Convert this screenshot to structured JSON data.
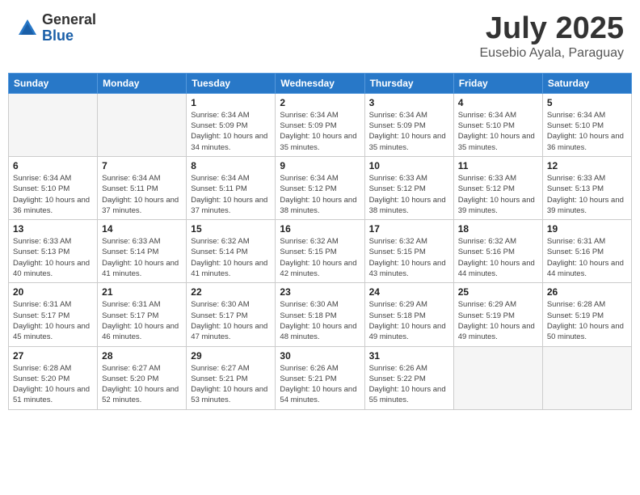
{
  "header": {
    "logo_general": "General",
    "logo_blue": "Blue",
    "month": "July 2025",
    "location": "Eusebio Ayala, Paraguay"
  },
  "weekdays": [
    "Sunday",
    "Monday",
    "Tuesday",
    "Wednesday",
    "Thursday",
    "Friday",
    "Saturday"
  ],
  "weeks": [
    [
      {
        "day": "",
        "info": ""
      },
      {
        "day": "",
        "info": ""
      },
      {
        "day": "1",
        "info": "Sunrise: 6:34 AM\nSunset: 5:09 PM\nDaylight: 10 hours and 34 minutes."
      },
      {
        "day": "2",
        "info": "Sunrise: 6:34 AM\nSunset: 5:09 PM\nDaylight: 10 hours and 35 minutes."
      },
      {
        "day": "3",
        "info": "Sunrise: 6:34 AM\nSunset: 5:09 PM\nDaylight: 10 hours and 35 minutes."
      },
      {
        "day": "4",
        "info": "Sunrise: 6:34 AM\nSunset: 5:10 PM\nDaylight: 10 hours and 35 minutes."
      },
      {
        "day": "5",
        "info": "Sunrise: 6:34 AM\nSunset: 5:10 PM\nDaylight: 10 hours and 36 minutes."
      }
    ],
    [
      {
        "day": "6",
        "info": "Sunrise: 6:34 AM\nSunset: 5:10 PM\nDaylight: 10 hours and 36 minutes."
      },
      {
        "day": "7",
        "info": "Sunrise: 6:34 AM\nSunset: 5:11 PM\nDaylight: 10 hours and 37 minutes."
      },
      {
        "day": "8",
        "info": "Sunrise: 6:34 AM\nSunset: 5:11 PM\nDaylight: 10 hours and 37 minutes."
      },
      {
        "day": "9",
        "info": "Sunrise: 6:34 AM\nSunset: 5:12 PM\nDaylight: 10 hours and 38 minutes."
      },
      {
        "day": "10",
        "info": "Sunrise: 6:33 AM\nSunset: 5:12 PM\nDaylight: 10 hours and 38 minutes."
      },
      {
        "day": "11",
        "info": "Sunrise: 6:33 AM\nSunset: 5:12 PM\nDaylight: 10 hours and 39 minutes."
      },
      {
        "day": "12",
        "info": "Sunrise: 6:33 AM\nSunset: 5:13 PM\nDaylight: 10 hours and 39 minutes."
      }
    ],
    [
      {
        "day": "13",
        "info": "Sunrise: 6:33 AM\nSunset: 5:13 PM\nDaylight: 10 hours and 40 minutes."
      },
      {
        "day": "14",
        "info": "Sunrise: 6:33 AM\nSunset: 5:14 PM\nDaylight: 10 hours and 41 minutes."
      },
      {
        "day": "15",
        "info": "Sunrise: 6:32 AM\nSunset: 5:14 PM\nDaylight: 10 hours and 41 minutes."
      },
      {
        "day": "16",
        "info": "Sunrise: 6:32 AM\nSunset: 5:15 PM\nDaylight: 10 hours and 42 minutes."
      },
      {
        "day": "17",
        "info": "Sunrise: 6:32 AM\nSunset: 5:15 PM\nDaylight: 10 hours and 43 minutes."
      },
      {
        "day": "18",
        "info": "Sunrise: 6:32 AM\nSunset: 5:16 PM\nDaylight: 10 hours and 44 minutes."
      },
      {
        "day": "19",
        "info": "Sunrise: 6:31 AM\nSunset: 5:16 PM\nDaylight: 10 hours and 44 minutes."
      }
    ],
    [
      {
        "day": "20",
        "info": "Sunrise: 6:31 AM\nSunset: 5:17 PM\nDaylight: 10 hours and 45 minutes."
      },
      {
        "day": "21",
        "info": "Sunrise: 6:31 AM\nSunset: 5:17 PM\nDaylight: 10 hours and 46 minutes."
      },
      {
        "day": "22",
        "info": "Sunrise: 6:30 AM\nSunset: 5:17 PM\nDaylight: 10 hours and 47 minutes."
      },
      {
        "day": "23",
        "info": "Sunrise: 6:30 AM\nSunset: 5:18 PM\nDaylight: 10 hours and 48 minutes."
      },
      {
        "day": "24",
        "info": "Sunrise: 6:29 AM\nSunset: 5:18 PM\nDaylight: 10 hours and 49 minutes."
      },
      {
        "day": "25",
        "info": "Sunrise: 6:29 AM\nSunset: 5:19 PM\nDaylight: 10 hours and 49 minutes."
      },
      {
        "day": "26",
        "info": "Sunrise: 6:28 AM\nSunset: 5:19 PM\nDaylight: 10 hours and 50 minutes."
      }
    ],
    [
      {
        "day": "27",
        "info": "Sunrise: 6:28 AM\nSunset: 5:20 PM\nDaylight: 10 hours and 51 minutes."
      },
      {
        "day": "28",
        "info": "Sunrise: 6:27 AM\nSunset: 5:20 PM\nDaylight: 10 hours and 52 minutes."
      },
      {
        "day": "29",
        "info": "Sunrise: 6:27 AM\nSunset: 5:21 PM\nDaylight: 10 hours and 53 minutes."
      },
      {
        "day": "30",
        "info": "Sunrise: 6:26 AM\nSunset: 5:21 PM\nDaylight: 10 hours and 54 minutes."
      },
      {
        "day": "31",
        "info": "Sunrise: 6:26 AM\nSunset: 5:22 PM\nDaylight: 10 hours and 55 minutes."
      },
      {
        "day": "",
        "info": ""
      },
      {
        "day": "",
        "info": ""
      }
    ]
  ]
}
